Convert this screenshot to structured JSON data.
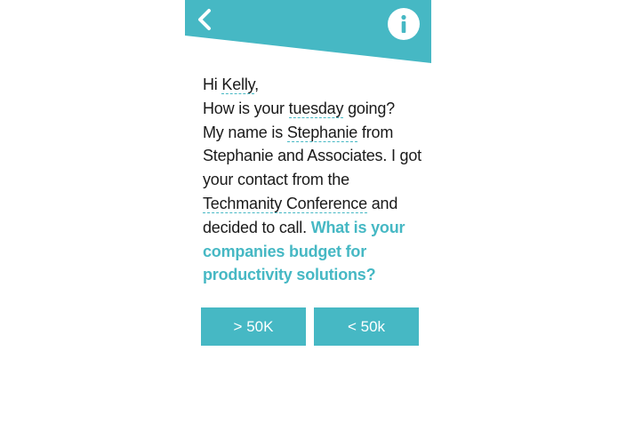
{
  "colors": {
    "accent": "#46b8c4",
    "text": "#1a1a1a",
    "background": "#ffffff"
  },
  "header": {
    "back_icon": "chevron-left-icon",
    "info_icon": "info-icon"
  },
  "message": {
    "greeting": "Hi ",
    "recipient_name": "Kelly",
    "greeting_end": ",",
    "line2_start": "How is your ",
    "weekday": "tuesday",
    "line2_end": " going?",
    "line3_start": "My name is ",
    "sender_name": "Stephanie",
    "line3_mid": " from Stephanie and Associates. I got your contact from the ",
    "event_name": "Techmanity Conference",
    "line3_end": " and decided to call. ",
    "question": "What is your companies budget for productivity solutions?"
  },
  "options": [
    {
      "label": "> 50K"
    },
    {
      "label": "< 50k"
    }
  ]
}
